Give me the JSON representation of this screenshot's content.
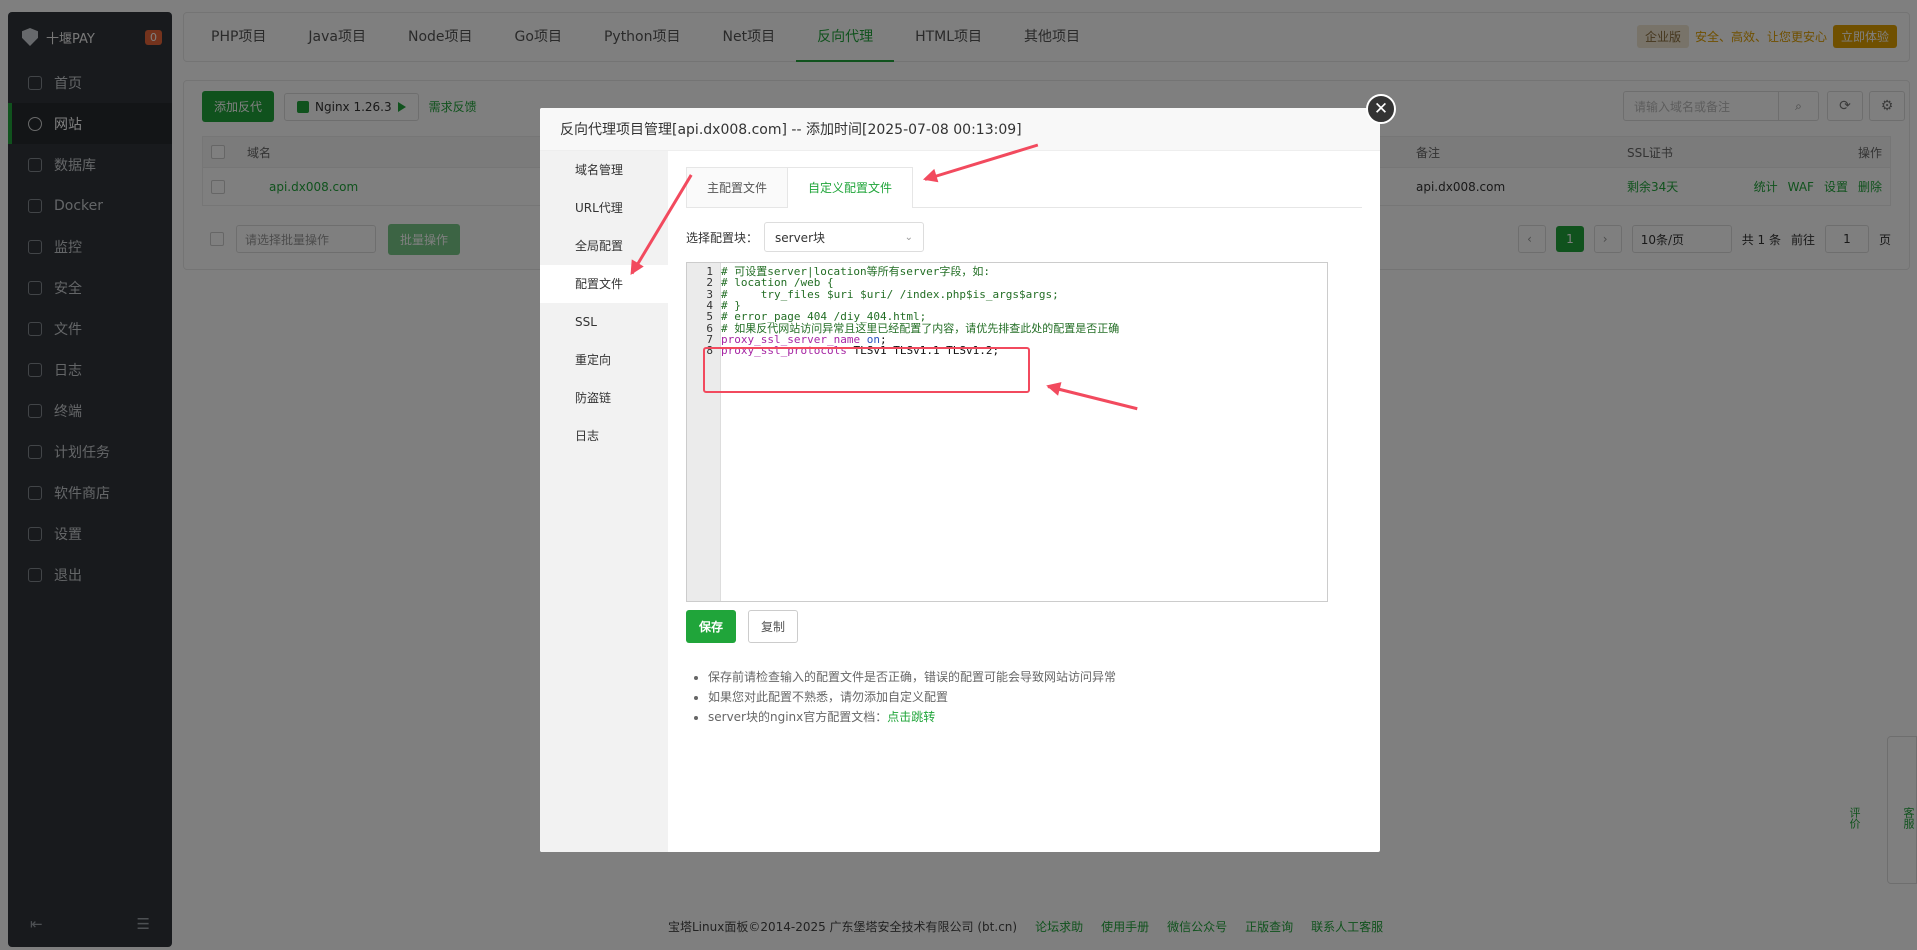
{
  "sidebar": {
    "brand": "十堰PAY",
    "badge": "0",
    "items": [
      "首页",
      "网站",
      "数据库",
      "Docker",
      "监控",
      "安全",
      "文件",
      "日志",
      "终端",
      "计划任务",
      "软件商店",
      "设置",
      "退出"
    ],
    "active": 1
  },
  "tabs": [
    "PHP项目",
    "Java项目",
    "Node项目",
    "Go项目",
    "Python项目",
    "Net项目",
    "反向代理",
    "HTML项目",
    "其他项目"
  ],
  "active_tab": 6,
  "enterprise": {
    "label": "企业版",
    "message": "安全、高效、让您更安心",
    "button": "立即体验"
  },
  "toolbar": {
    "add_proxy": "添加反代",
    "nginx": "Nginx 1.26.3",
    "feedback": "需求反馈",
    "search_placeholder": "请输入域名或备注"
  },
  "table": {
    "headers": {
      "domain": "域名",
      "remark": "备注",
      "ssl": "SSL证书",
      "ops": "操作"
    },
    "row": {
      "domain": "api.dx008.com",
      "remark": "api.dx008.com",
      "ssl": "剩余34天",
      "ops": [
        "统计",
        "WAF",
        "设置",
        "删除"
      ]
    }
  },
  "footer_bar": {
    "batch_placeholder": "请选择批量操作",
    "batch_button": "批量操作",
    "page": "1",
    "per_page": "10条/页",
    "total": "共 1 条",
    "goto": "前往",
    "goto_value": "1",
    "page_unit": "页"
  },
  "modal": {
    "title": "反向代理项目管理[api.dx008.com] -- 添加时间[2025-07-08 00:13:09]",
    "side": [
      "域名管理",
      "URL代理",
      "全局配置",
      "配置文件",
      "SSL",
      "重定向",
      "防盗链",
      "日志"
    ],
    "side_active": 3,
    "tabs": [
      "主配置文件",
      "自定义配置文件"
    ],
    "tab_active": 1,
    "select_label": "选择配置块：",
    "select_value": "server块",
    "code": [
      {
        "n": "1",
        "t": "# 可设置server|location等所有server字段，如:"
      },
      {
        "n": "2",
        "t": "# location /web {"
      },
      {
        "n": "3",
        "t": "#     try_files $uri $uri/ /index.php$is_args$args;"
      },
      {
        "n": "4",
        "t": "# }"
      },
      {
        "n": "5",
        "t": "# error_page 404 /diy_404.html;"
      },
      {
        "n": "6",
        "t": "# 如果反代网站访问异常且这里已经配置了内容，请优先排查此处的配置是否正确"
      },
      {
        "n": "7",
        "k": "proxy_ssl_server_name",
        "v": "on",
        "e": ";"
      },
      {
        "n": "8",
        "k": "proxy_ssl_protocols",
        "v": "TLSv1 TLSv1.1 TLSv1.2",
        "e": ";"
      }
    ],
    "save": "保存",
    "copy": "复制",
    "tips": [
      "保存前请检查输入的配置文件是否正确，错误的配置可能会导致网站访问异常",
      "如果您对此配置不熟悉，请勿添加自定义配置",
      "server块的nginx官方配置文档："
    ],
    "tip_link": "点击跳转"
  },
  "footer": {
    "copyright": "宝塔Linux面板©2014-2025 广东堡塔安全技术有限公司 (bt.cn)",
    "links": [
      "论坛求助",
      "使用手册",
      "微信公众号",
      "正版查询",
      "联系人工客服"
    ]
  },
  "float": [
    "客服",
    "评价"
  ]
}
